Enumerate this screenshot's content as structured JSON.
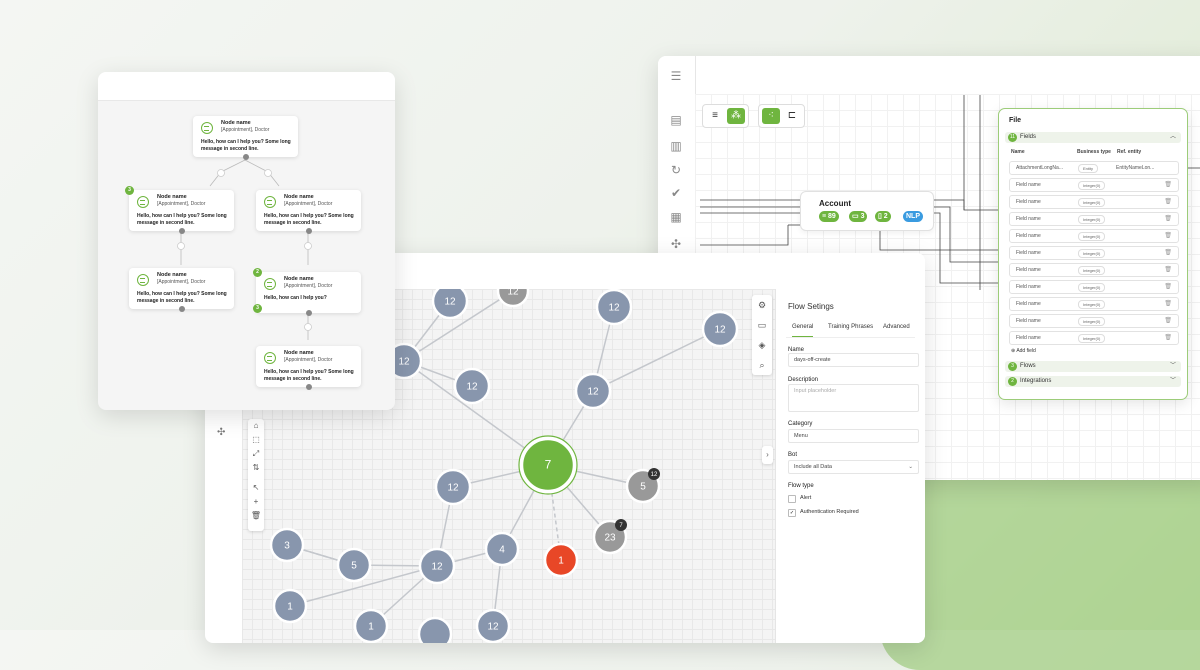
{
  "theme": {
    "accent": "#6fb53f",
    "node_gray": "#8896ad",
    "node_dim": "#999999",
    "node_red": "#e84727"
  },
  "flow_window": {
    "nodes": [
      {
        "name": "Node name",
        "subtitle": "[Appointment], Doctor",
        "message": "Hello, how can I help you?  Some long message in second line."
      },
      {
        "name": "Node name",
        "subtitle": "[Appointment], Doctor",
        "message": "Hello, how can I help you?  Some long message in second line."
      },
      {
        "name": "Node name",
        "subtitle": "[Appointment], Doctor",
        "message": "Hello, how can I help you?  Some long message in second line."
      },
      {
        "name": "Node name",
        "subtitle": "[Appointment], Doctor",
        "message": "Hello, how can I help you?  Some long message in second line."
      },
      {
        "name": "Node name",
        "subtitle": "[Appointment], Doctor",
        "message": "Hello, how can I help you?"
      },
      {
        "name": "Node name",
        "subtitle": "[Appointment], Doctor",
        "message": "Hello, how can I help you?  Some long message in second line."
      }
    ],
    "badges": [
      "3",
      "2",
      "3"
    ]
  },
  "schema_window": {
    "account": {
      "title": "Account",
      "count_a": "89",
      "count_b": "3",
      "count_c": "2",
      "nlp": "NLP"
    },
    "file": {
      "title": "File",
      "fields_section": {
        "count": "11",
        "label": "Fields"
      },
      "columns": {
        "name": "Name",
        "business_type": "Business type",
        "ref_entity": "Ref. entity"
      },
      "first_row": {
        "name": "AttachmentLongNa...",
        "type": "Entity",
        "ref": "EntityNameLon..."
      },
      "rows": [
        {
          "name": "Field name",
          "type": "Integer(0)"
        },
        {
          "name": "Field name",
          "type": "Integer(0)"
        },
        {
          "name": "Field name",
          "type": "Integer(0)"
        },
        {
          "name": "Field name",
          "type": "Integer(0)"
        },
        {
          "name": "Field name",
          "type": "Integer(0)"
        },
        {
          "name": "Field name",
          "type": "Integer(0)"
        },
        {
          "name": "Field name",
          "type": "Integer(0)"
        },
        {
          "name": "Field name",
          "type": "Integer(0)"
        },
        {
          "name": "Field name",
          "type": "Integer(0)"
        },
        {
          "name": "Field name",
          "type": "Integer(0)"
        }
      ],
      "add_field": "Add field",
      "flows_section": {
        "count": "3",
        "label": "Flows"
      },
      "integrations_section": {
        "count": "2",
        "label": "Integrations"
      }
    }
  },
  "graph_window": {
    "nodes": [
      {
        "label": "12",
        "color": "gray"
      },
      {
        "label": "12",
        "color": "dim"
      },
      {
        "label": "12",
        "color": "gray"
      },
      {
        "label": "12",
        "color": "gray"
      },
      {
        "label": "12",
        "color": "gray"
      },
      {
        "label": "12",
        "color": "gray"
      },
      {
        "label": "12",
        "color": "gray"
      },
      {
        "label": "7",
        "color": "green"
      },
      {
        "label": "12",
        "color": "gray"
      },
      {
        "label": "5",
        "color": "dim",
        "badge": "12"
      },
      {
        "label": "23",
        "color": "dim",
        "badge": "7"
      },
      {
        "label": "4",
        "color": "gray"
      },
      {
        "label": "1",
        "color": "red"
      },
      {
        "label": "3",
        "color": "gray"
      },
      {
        "label": "5",
        "color": "gray"
      },
      {
        "label": "12",
        "color": "gray"
      },
      {
        "label": "1",
        "color": "gray"
      },
      {
        "label": "1",
        "color": "gray"
      },
      {
        "label": "12",
        "color": "gray"
      },
      {
        "label": "",
        "color": "gray"
      }
    ],
    "panel": {
      "title": "Flow Setings",
      "tabs": [
        "General",
        "Training Phrases",
        "Advanced"
      ],
      "name_label": "Name",
      "name_value": "days-off-create",
      "description_label": "Description",
      "description_placeholder": "Input placeholder",
      "category_label": "Category",
      "category_value": "Menu",
      "bot_label": "Bot",
      "bot_value": "Include all Data",
      "flow_type_label": "Flow type",
      "flow_types": [
        {
          "label": "Alert",
          "checked": false
        },
        {
          "label": "Authentication Required",
          "checked": true
        }
      ]
    }
  }
}
